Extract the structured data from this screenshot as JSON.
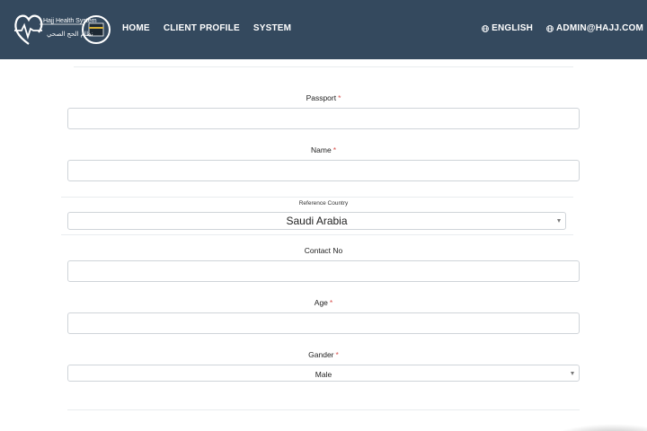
{
  "header": {
    "logo_text_en": "Hajj Health System",
    "logo_text_ar": "نظام الحج الصحي",
    "nav": [
      "HOME",
      "CLIENT PROFILE",
      "SYSTEM"
    ],
    "language": "ENGLISH",
    "user": "ADMIN@HAJJ.COM",
    "bg_color": "#34495e"
  },
  "form": {
    "passport_label": "Passport",
    "name_label": "Name",
    "reference_country_label": "Reference Country",
    "reference_country_value": "Saudi Arabia",
    "contact_label": "Contact No",
    "age_label": "Age",
    "gender_label": "Gander",
    "gender_value": "Male",
    "required_mark": "*"
  },
  "colors": {
    "required": "#d9534f",
    "input_border": "#cfd4d9"
  }
}
